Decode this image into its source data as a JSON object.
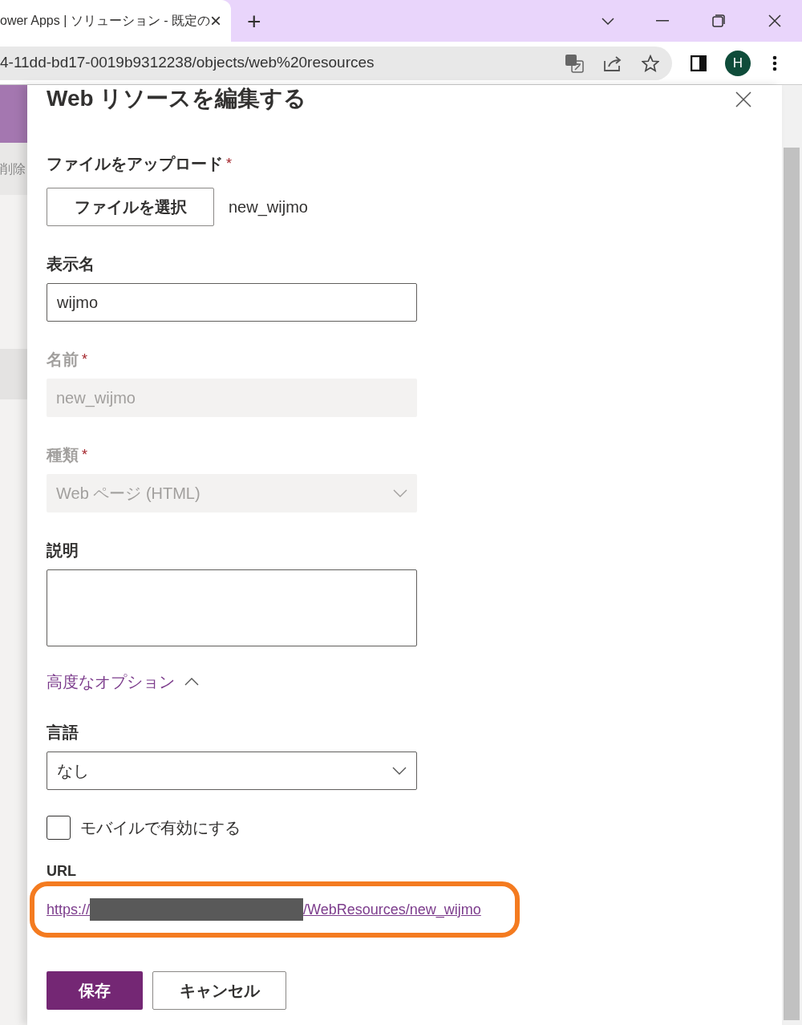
{
  "browser": {
    "tab": {
      "title": "ower Apps | ソリューション - 既定の",
      "close": "×"
    },
    "new_tab": "+",
    "address": "4-11dd-bd17-0019b9312238/objects/web%20resources",
    "profile": "H"
  },
  "background": {
    "command": "削除"
  },
  "panel": {
    "title": "Web リソースを編集する",
    "fields": [
      {
        "kind": "file",
        "label": "ファイルをアップロード",
        "required_mark": "*",
        "button": "ファイルを選択",
        "file_name": "new_wijmo"
      },
      {
        "kind": "text",
        "label": "表示名",
        "value": "wijmo",
        "disabled": false
      },
      {
        "kind": "text",
        "label": "名前",
        "required_mark": "*",
        "value": "new_wijmo",
        "disabled": true
      },
      {
        "kind": "select",
        "label": "種類",
        "required_mark": "*",
        "value": "Web ページ (HTML)",
        "disabled": true
      },
      {
        "kind": "textarea",
        "label": "説明"
      }
    ],
    "advanced": {
      "label": "高度なオプション",
      "expanded": true
    },
    "advanced_fields": [
      {
        "kind": "select",
        "label": "言語",
        "value": "なし",
        "disabled": false
      },
      {
        "kind": "checkbox",
        "label": "モバイルで有効にする",
        "checked": false
      },
      {
        "kind": "link",
        "label": "URL",
        "prefix": "https://",
        "suffix": "/WebResources/new_wijmo",
        "highlighted": true
      }
    ],
    "buttons": [
      {
        "label": "保存",
        "primary": true
      },
      {
        "label": "キャンセル",
        "primary": false
      }
    ]
  }
}
